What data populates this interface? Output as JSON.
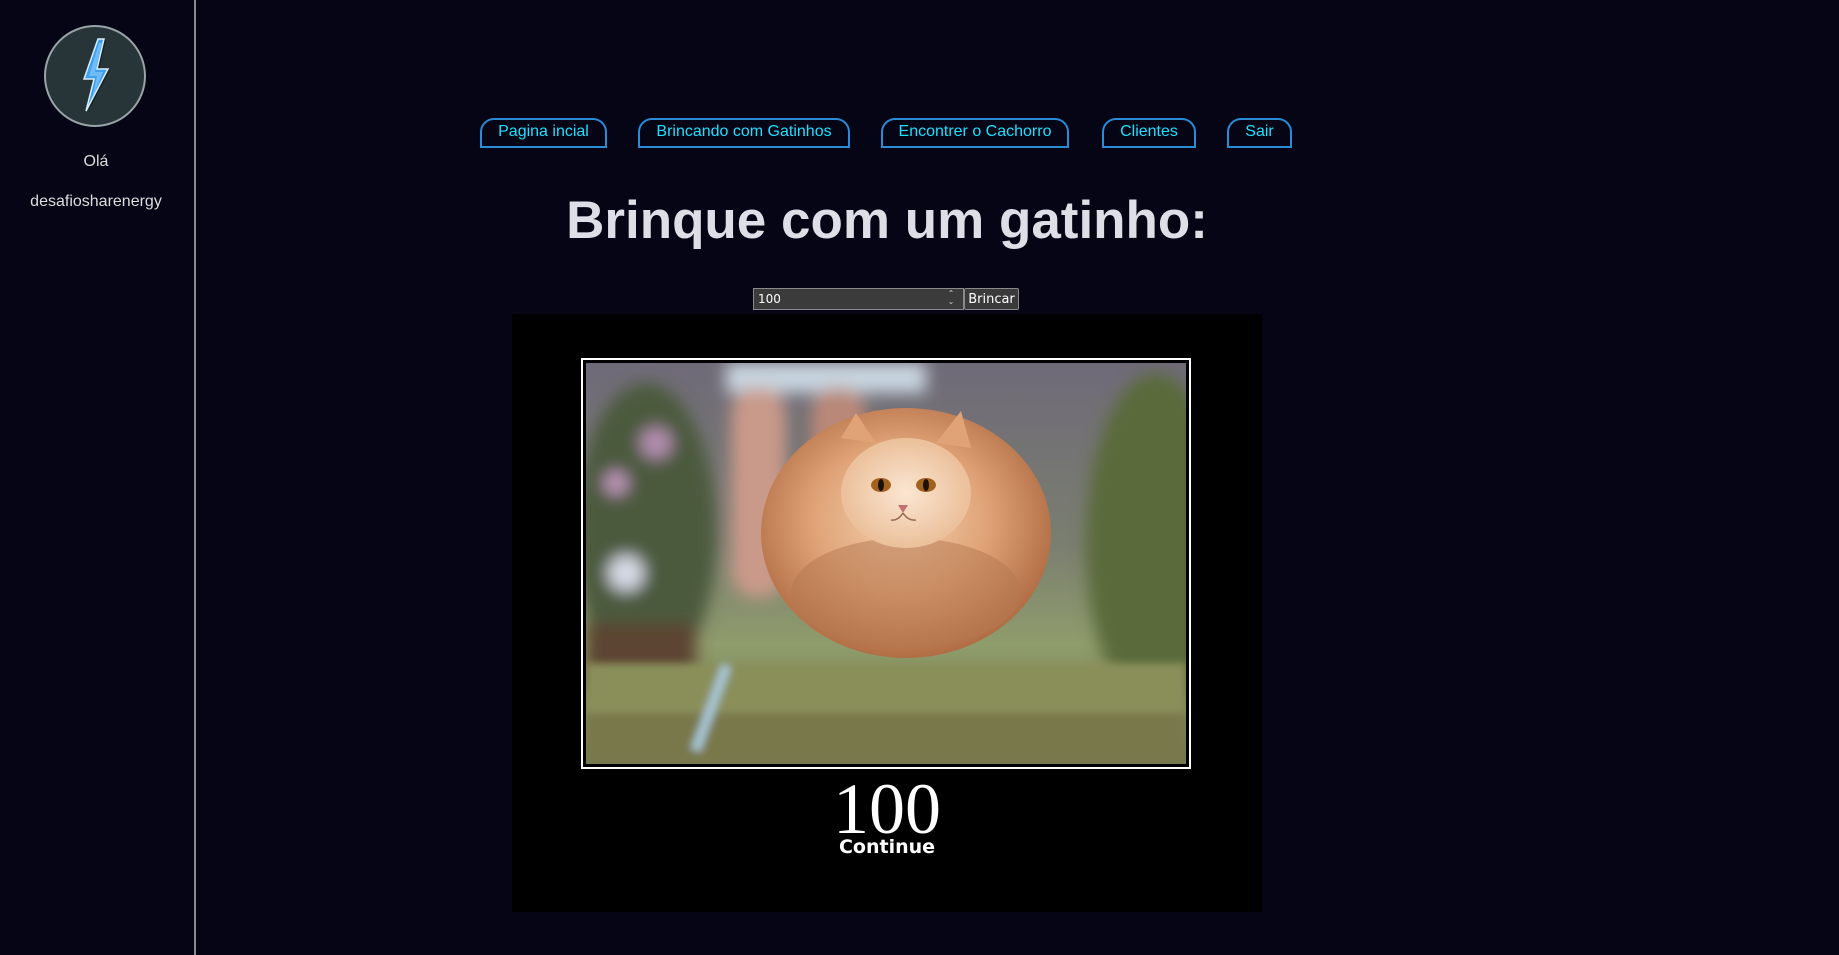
{
  "sidebar": {
    "logo_icon": "lightning-bolt-icon",
    "greeting": "Olá",
    "username": "desafiosharenergy"
  },
  "nav": {
    "items": [
      {
        "label": "Pagina incial"
      },
      {
        "label": "Brincando com Gatinhos"
      },
      {
        "label": "Encontrer o Cachorro"
      },
      {
        "label": "Clientes"
      },
      {
        "label": "Sair"
      }
    ]
  },
  "main": {
    "title": "Brinque com um gatinho:",
    "status_input": {
      "value": "100"
    },
    "play_button_label": "Brincar",
    "cat_image": {
      "status_code": "100",
      "caption": "Continue"
    }
  },
  "colors": {
    "background": "#050515",
    "nav_text": "#1ee0ff",
    "nav_border": "#2a8bd6",
    "title": "#dedee6"
  }
}
